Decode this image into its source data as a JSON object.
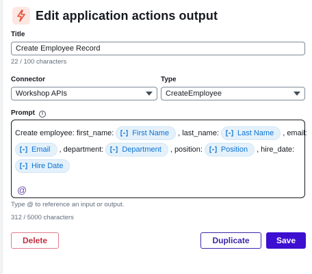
{
  "header": {
    "title": "Edit application actions output",
    "icon": "lightning-icon"
  },
  "title_field": {
    "label": "Title",
    "value": "Create Employee Record",
    "counter": "22 / 100 characters"
  },
  "connector_field": {
    "label": "Connector",
    "value": "Workshop APIs"
  },
  "type_field": {
    "label": "Type",
    "value": "CreateEmployee"
  },
  "prompt_field": {
    "label": "Prompt",
    "line1": {
      "t1": "Create employee: first_name:",
      "token1": "First Name",
      "t2": ", last_name:",
      "token2": "Last Name",
      "t3": ", email:"
    },
    "line2": {
      "token3": "Email",
      "t4": ", department:",
      "token4": "Department",
      "t5": ", position:",
      "token5": "Position",
      "t6": ", hire_date:"
    },
    "line3": {
      "token6": "Hire Date"
    },
    "at_symbol": "@",
    "hint": "Type @ to reference an input or output.",
    "counter": "312 / 5000 characters"
  },
  "buttons": {
    "delete": "Delete",
    "duplicate": "Duplicate",
    "save": "Save"
  },
  "colors": {
    "accent": "#3d0fd1",
    "token_bg": "#e4f1fb",
    "token_text": "#0972d3",
    "danger": "#c0303e",
    "icon_bg": "#fde7e2",
    "icon_fg": "#e8533a"
  }
}
